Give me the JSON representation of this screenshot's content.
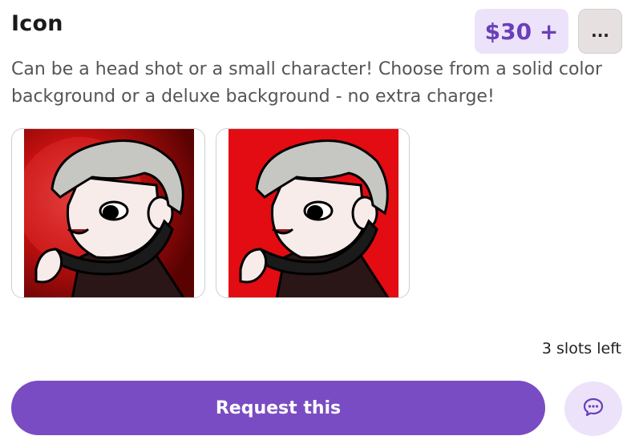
{
  "listing": {
    "title": "Icon",
    "price": "$30 +",
    "more_label": "...",
    "description": "Can be a head shot or a small character! Choose from a solid color background or a deluxe background - no extra charge!",
    "slots": "3 slots left",
    "request_label": "Request this"
  },
  "icons": {
    "more": "more-options-icon",
    "chat": "chat-bubble-icon"
  },
  "thumbnails": [
    {
      "name": "deluxe-background-example",
      "background": "gradient-red"
    },
    {
      "name": "solid-background-example",
      "background": "solid-red"
    }
  ],
  "colors": {
    "accent": "#7a4cc3",
    "accent_light": "#ece3fa",
    "price_text": "#6a3fb8",
    "solid_red": "#e20c12"
  }
}
